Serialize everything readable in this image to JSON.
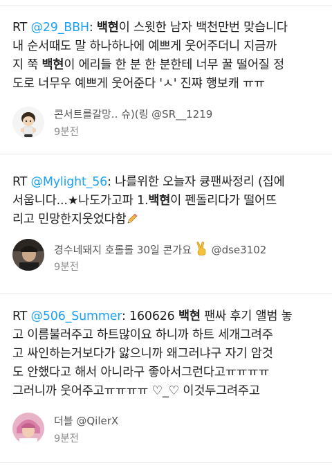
{
  "tweets": [
    {
      "lines": [
        {
          "parts": [
            {
              "t": "RT ",
              "k": "plain"
            },
            {
              "t": "@29_BBH",
              "k": "mention"
            },
            {
              "t": ": ",
              "k": "plain"
            },
            {
              "t": "백현",
              "k": "bold"
            },
            {
              "t": "이 스윗한 남자 백천만번 맞습니다",
              "k": "plain"
            }
          ]
        },
        {
          "parts": [
            {
              "t": "내 순서때도 말 하나하나에 예쁘게 웃어주더니 지금까",
              "k": "plain"
            }
          ]
        },
        {
          "parts": [
            {
              "t": "지 쭉 ",
              "k": "plain"
            },
            {
              "t": "백현",
              "k": "bold"
            },
            {
              "t": "이 에리들 한 분 한 분한테 너무 꿀 떨어질 정",
              "k": "plain"
            }
          ]
        },
        {
          "parts": [
            {
              "t": "도로 너무우 예쁘게 웃어준다 'ㅅ' 진쨔 행보캐 ㅠㅠ",
              "k": "plain"
            }
          ]
        }
      ],
      "author": "콘서트를갈망.. 슈)(링 @SR__1219",
      "time": "9분전",
      "avatar_icon": "cartoon-avatar"
    },
    {
      "lines": [
        {
          "parts": [
            {
              "t": "RT ",
              "k": "plain"
            },
            {
              "t": "@Mylight_56",
              "k": "mention"
            },
            {
              "t": ": 나를위한 오늘자 큥팬싸정리 (집에",
              "k": "plain"
            }
          ]
        },
        {
          "parts": [
            {
              "t": "서웁니다...★나도가고파 1.",
              "k": "plain"
            },
            {
              "t": "백현",
              "k": "bold"
            },
            {
              "t": "이 펜돌리다가 떨어뜨",
              "k": "plain"
            }
          ]
        },
        {
          "parts": [
            {
              "t": "리고 민망한지웃었다함",
              "k": "plain"
            }
          ],
          "pencil": true
        }
      ],
      "author": "경수네돼지 호롤롤 30일 콘가요",
      "author_handle": "@dse3102",
      "time": "9분전",
      "avatar_icon": "photo-avatar"
    },
    {
      "lines": [
        {
          "parts": [
            {
              "t": "RT ",
              "k": "plain"
            },
            {
              "t": "@506_Summer",
              "k": "mention"
            },
            {
              "t": ": 160626 ",
              "k": "plain"
            },
            {
              "t": "백현",
              "k": "bold"
            },
            {
              "t": " 팬싸 후기 앨범 놓",
              "k": "plain"
            }
          ]
        },
        {
          "parts": [
            {
              "t": "고 이름불러주고 하트많이요 하니까 하트 세개그려주",
              "k": "plain"
            }
          ]
        },
        {
          "parts": [
            {
              "t": "고 싸인하는거보다가 앓으니까 왜그러냐구 자기 암것",
              "k": "plain"
            }
          ]
        },
        {
          "parts": [
            {
              "t": "도 안했다고 해서 아니라구 좋아서그런다고ㅠㅠㅠㅠ",
              "k": "plain"
            }
          ]
        },
        {
          "parts": [
            {
              "t": "그러니까 웃어주고ㅠㅠㅠㅠ ♡_♡ 이것두그려주고",
              "k": "plain"
            }
          ]
        }
      ],
      "author": "더블 @QilerX",
      "time": "9분전",
      "avatar_icon": "photo-avatar-pink"
    }
  ],
  "colors": {
    "mention": "#1da1f2",
    "divider": "#e6e6e6",
    "time": "#8a8a8a"
  }
}
